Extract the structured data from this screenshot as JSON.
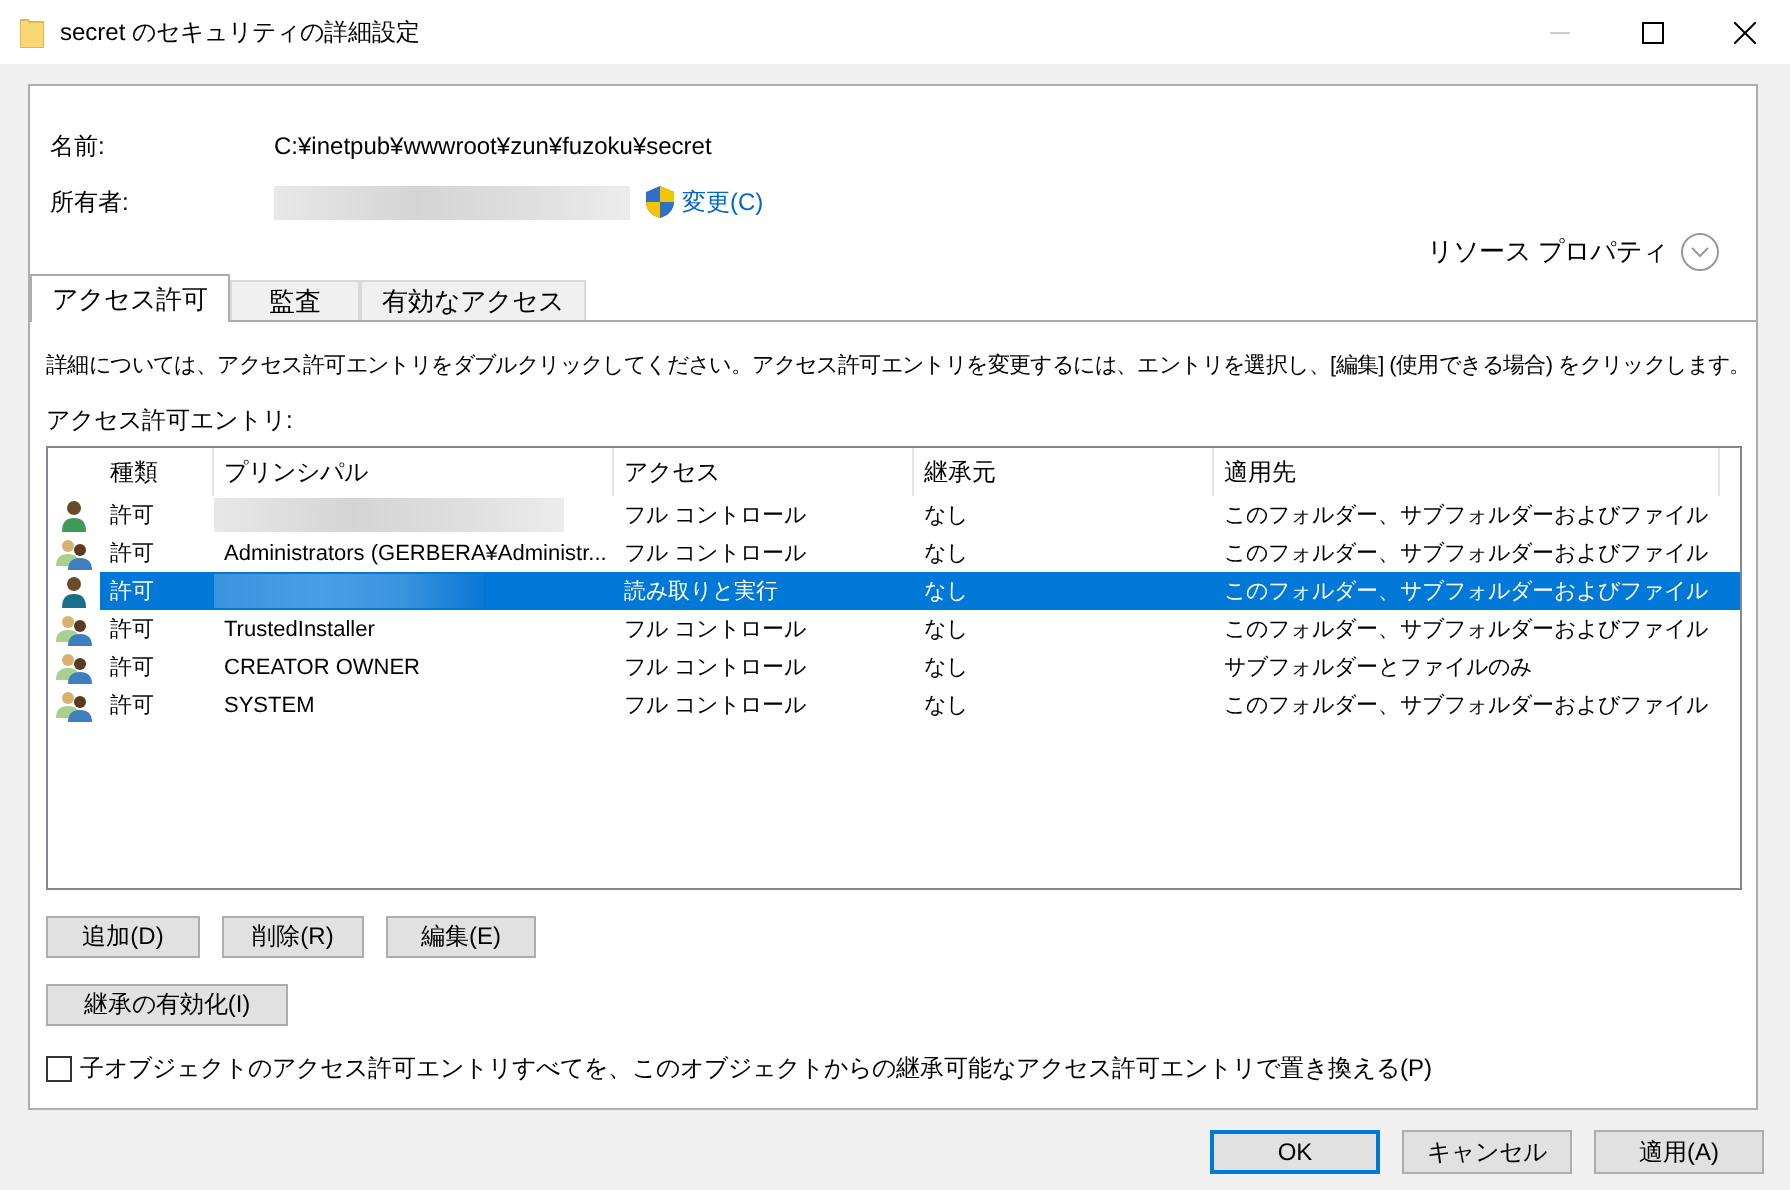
{
  "window": {
    "title": "secret のセキュリティの詳細設定"
  },
  "info": {
    "name_label": "名前:",
    "name_value": "C:¥inetpub¥wwwroot¥zun¥fuzoku¥secret",
    "owner_label": "所有者:",
    "owner_redacted": true,
    "change_link": "変更(C)",
    "resource_properties": "リソース プロパティ"
  },
  "tabs": [
    {
      "label": "アクセス許可",
      "selected": true
    },
    {
      "label": "監査",
      "selected": false
    },
    {
      "label": "有効なアクセス",
      "selected": false
    }
  ],
  "description": "詳細については、アクセス許可エントリをダブルクリックしてください。アクセス許可エントリを変更するには、エントリを選択し、[編集] (使用できる場合) をクリックします。",
  "entries_label": "アクセス許可エントリ:",
  "table": {
    "columns": [
      "種類",
      "プリンシパル",
      "アクセス",
      "継承元",
      "適用先"
    ],
    "rows": [
      {
        "kind": "user",
        "type": "許可",
        "principal": "",
        "redacted": true,
        "access": "フル コントロール",
        "inherited_from": "なし",
        "applies_to": "このフォルダー、サブフォルダーおよびファイル",
        "selected": false
      },
      {
        "kind": "group",
        "type": "許可",
        "principal": "Administrators (GERBERA¥Administr...",
        "redacted": false,
        "access": "フル コントロール",
        "inherited_from": "なし",
        "applies_to": "このフォルダー、サブフォルダーおよびファイル",
        "selected": false
      },
      {
        "kind": "user",
        "type": "許可",
        "principal": "",
        "redacted": true,
        "access": "読み取りと実行",
        "inherited_from": "なし",
        "applies_to": "このフォルダー、サブフォルダーおよびファイル",
        "selected": true
      },
      {
        "kind": "group",
        "type": "許可",
        "principal": "TrustedInstaller",
        "redacted": false,
        "access": "フル コントロール",
        "inherited_from": "なし",
        "applies_to": "このフォルダー、サブフォルダーおよびファイル",
        "selected": false
      },
      {
        "kind": "group",
        "type": "許可",
        "principal": "CREATOR OWNER",
        "redacted": false,
        "access": "フル コントロール",
        "inherited_from": "なし",
        "applies_to": "サブフォルダーとファイルのみ",
        "selected": false
      },
      {
        "kind": "group",
        "type": "許可",
        "principal": "SYSTEM",
        "redacted": false,
        "access": "フル コントロール",
        "inherited_from": "なし",
        "applies_to": "このフォルダー、サブフォルダーおよびファイル",
        "selected": false
      }
    ]
  },
  "entry_buttons": [
    "追加(D)",
    "削除(R)",
    "編集(E)"
  ],
  "inheritance_button": "継承の有効化(I)",
  "replace_checkbox": {
    "label": "子オブジェクトのアクセス許可エントリすべてを、このオブジェクトからの継承可能なアクセス許可エントリで置き換える(P)",
    "checked": false
  },
  "dialog_buttons": [
    {
      "label": "OK",
      "default": true
    },
    {
      "label": "キャンセル",
      "default": false
    },
    {
      "label": "適用(A)",
      "default": false
    }
  ]
}
